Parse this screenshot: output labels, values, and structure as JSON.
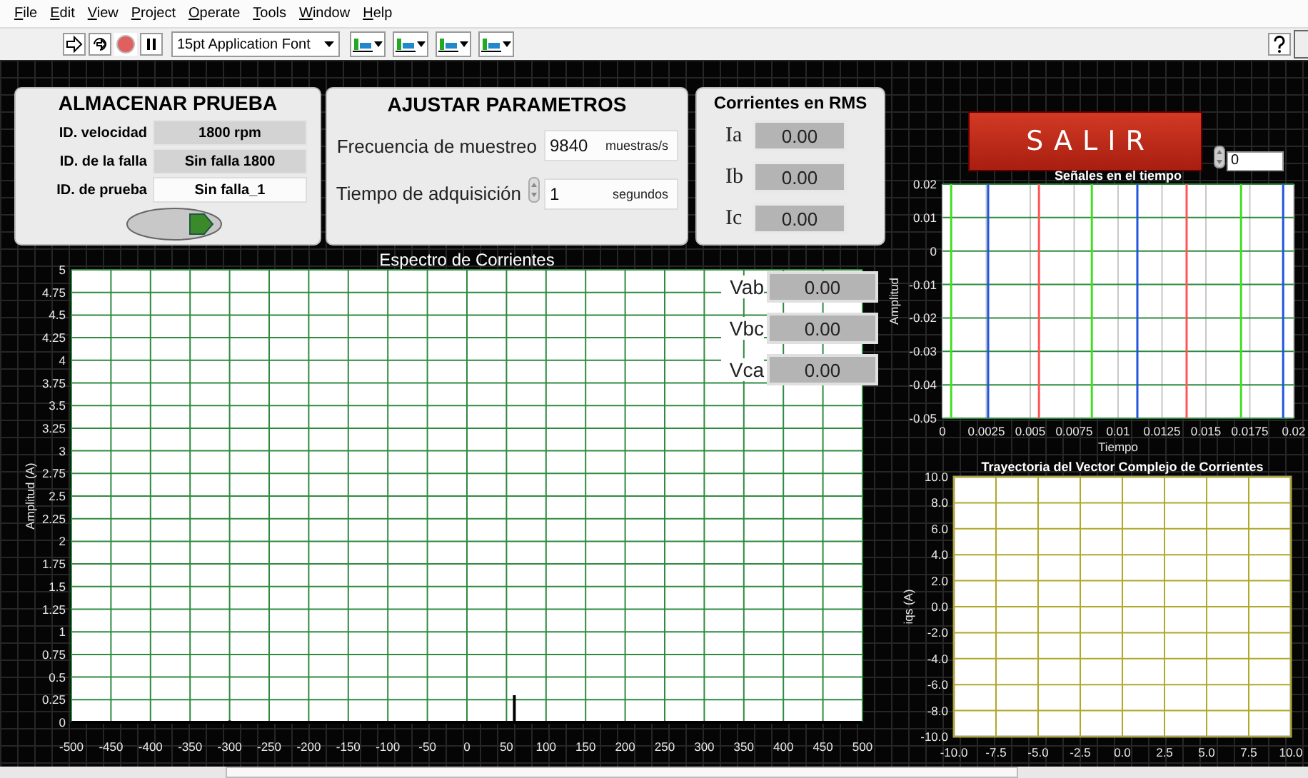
{
  "menu": [
    "File",
    "Edit",
    "View",
    "Project",
    "Operate",
    "Tools",
    "Window",
    "Help"
  ],
  "toolbar": {
    "font": "15pt Application Font"
  },
  "almacenar": {
    "title": "ALMACENAR PRUEBA",
    "fields": [
      {
        "label": "ID. velocidad",
        "value": "1800 rpm",
        "kind": "indicator"
      },
      {
        "label": "ID. de la falla",
        "value": "Sin falla 1800",
        "kind": "indicator"
      },
      {
        "label": "ID. de prueba",
        "value": "Sin falla_1",
        "kind": "control"
      }
    ]
  },
  "ajustar": {
    "title": "AJUSTAR PARAMETROS",
    "fields": [
      {
        "label": "Frecuencia de muestreo",
        "value": "9840",
        "unit": "muestras/s",
        "kind": "numeric"
      },
      {
        "label": "Tiempo de adquisición",
        "value": "1",
        "unit": "segundos",
        "kind": "spinner"
      }
    ]
  },
  "rms": {
    "title": "Corrientes en RMS",
    "items": [
      {
        "label": "Ia",
        "value": "0.00"
      },
      {
        "label": "Ib",
        "value": "0.00"
      },
      {
        "label": "Ic",
        "value": "0.00"
      }
    ]
  },
  "salir": {
    "label": "SALIR"
  },
  "counter": {
    "value": "0"
  },
  "voltages": [
    {
      "label": "Vab",
      "value": "0.00"
    },
    {
      "label": "Vbc",
      "value": "0.00"
    },
    {
      "label": "Vca",
      "value": "0.00"
    }
  ],
  "spectrum": {
    "chart_data": {
      "type": "line",
      "title": "Espectro de Corrientes",
      "ylabel": "Amplitud (A)",
      "x": [
        -500,
        -300,
        -300,
        -300,
        60,
        60,
        60,
        500
      ],
      "grid": true,
      "series": [
        {
          "color": "#000000",
          "values": [
            0,
            0,
            0.02,
            0,
            0,
            0.3,
            0,
            0
          ]
        }
      ],
      "xlim": [
        -500,
        500
      ],
      "ylim": [
        0,
        5
      ],
      "xticks": [
        -500,
        -450,
        -400,
        -350,
        -300,
        -250,
        -200,
        -150,
        -100,
        -50,
        0,
        50,
        100,
        150,
        200,
        250,
        300,
        350,
        400,
        450,
        500
      ],
      "yticks": [
        0,
        0.25,
        0.5,
        0.75,
        1,
        1.25,
        1.5,
        1.75,
        2,
        2.25,
        2.5,
        2.75,
        3,
        3.25,
        3.5,
        3.75,
        4,
        4.25,
        4.5,
        4.75,
        5
      ]
    }
  },
  "time_signals": {
    "chart_data": {
      "type": "line",
      "title": "Señales en el tiempo",
      "xlabel": "Tiempo",
      "ylabel": "Amplitud",
      "grid": true,
      "x": [
        0.0005,
        0.0005,
        0.0026,
        0.0026,
        0.0055,
        0.0055,
        0.0085,
        0.0085,
        0.0111,
        0.0111,
        0.0139,
        0.0139,
        0.017,
        0.017,
        0.0194,
        0.0194
      ],
      "series": [
        {
          "color": "#44dd22",
          "values": [
            0.02,
            -0.05,
            null,
            null,
            null,
            null,
            0.02,
            -0.05,
            null,
            null,
            null,
            null,
            0.02,
            -0.05,
            null,
            null
          ]
        },
        {
          "color": "#2255dd",
          "values": [
            null,
            null,
            0.02,
            -0.05,
            null,
            null,
            null,
            null,
            0.02,
            -0.05,
            null,
            null,
            null,
            null,
            0.02,
            -0.05
          ]
        },
        {
          "color": "#ff5555",
          "values": [
            null,
            null,
            null,
            null,
            0.02,
            -0.05,
            null,
            null,
            null,
            null,
            0.02,
            -0.05,
            null,
            null,
            null,
            null
          ]
        }
      ],
      "xlim": [
        0,
        0.02
      ],
      "ylim": [
        -0.05,
        0.02
      ],
      "xticks": [
        0,
        0.0025,
        0.005,
        0.0075,
        0.01,
        0.0125,
        0.015,
        0.0175,
        0.02
      ],
      "yticks": [
        -0.05,
        -0.04,
        -0.03,
        -0.02,
        -0.01,
        0,
        0.01,
        0.02
      ]
    }
  },
  "trajectory": {
    "chart_data": {
      "type": "scatter",
      "title": "Trayectoria del Vector Complejo de Corrientes",
      "ylabel": "iqs (A)",
      "grid": true,
      "xlim": [
        -10,
        10
      ],
      "ylim": [
        -10,
        10
      ],
      "xticks": [
        {
          "value": -10,
          "label": "-10.0"
        },
        {
          "value": -7.5,
          "label": "-7.5"
        },
        {
          "value": -5,
          "label": "-5.0"
        },
        {
          "value": -2.5,
          "label": "-2.5"
        },
        {
          "value": 0,
          "label": "0.0"
        },
        {
          "value": 2.5,
          "label": "2.5"
        },
        {
          "value": 5,
          "label": "5.0"
        },
        {
          "value": 7.5,
          "label": "7.5"
        },
        {
          "value": 10,
          "label": "10.0"
        }
      ],
      "yticks": [
        {
          "value": -10,
          "label": "-10.0"
        },
        {
          "value": -8,
          "label": "-8.0"
        },
        {
          "value": -6,
          "label": "-6.0"
        },
        {
          "value": -4,
          "label": "-4.0"
        },
        {
          "value": -2,
          "label": "-2.0"
        },
        {
          "value": 0,
          "label": "0.0"
        },
        {
          "value": 2,
          "label": "2.0"
        },
        {
          "value": 4,
          "label": "4.0"
        },
        {
          "value": 6,
          "label": "6.0"
        },
        {
          "value": 8,
          "label": "8.0"
        },
        {
          "value": 10,
          "label": "10.0"
        }
      ]
    }
  }
}
